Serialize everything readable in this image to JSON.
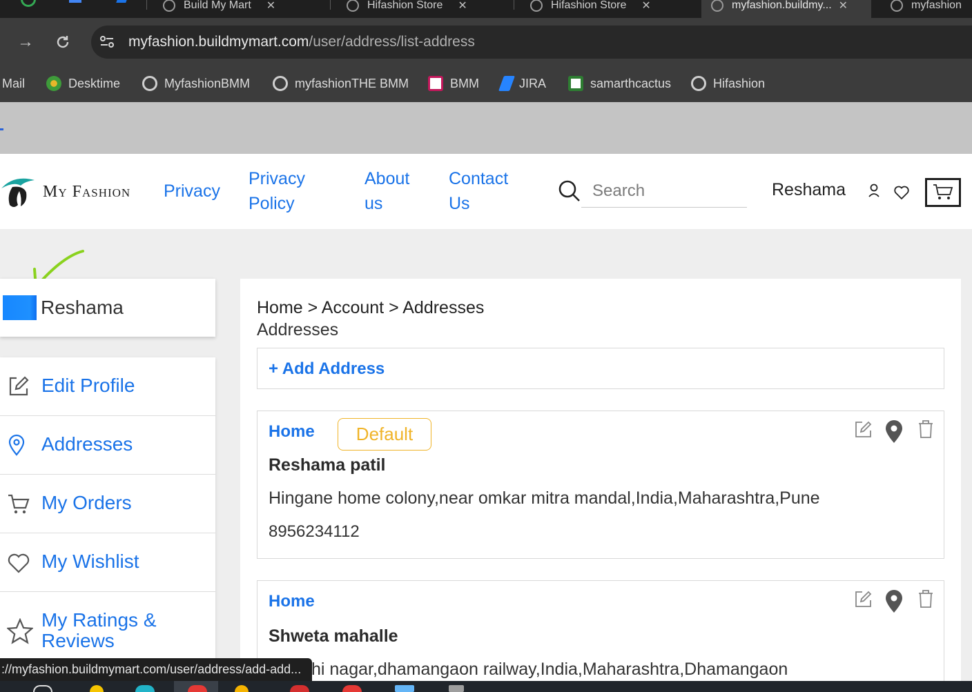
{
  "browser": {
    "tabs": [
      {
        "title": "Build My Mart"
      },
      {
        "title": "Hifashion Store"
      },
      {
        "title": "Hifashion Store"
      },
      {
        "title": "myfashion.buildmy..."
      },
      {
        "title": "myfashion"
      }
    ],
    "url_host": "myfashion.buildmymart.com",
    "url_path": "/user/address/list-address",
    "bookmarks": [
      {
        "label": "Mail"
      },
      {
        "label": "Desktime"
      },
      {
        "label": "MyfashionBMM"
      },
      {
        "label": "myfashionTHE BMM"
      },
      {
        "label": "BMM"
      },
      {
        "label": "JIRA"
      },
      {
        "label": "samarthcactus"
      },
      {
        "label": "Hifashion"
      }
    ],
    "status_url": "://myfashion.buildmymart.com/user/address/add-add..."
  },
  "header": {
    "logo_text": "My Fashion",
    "nav": [
      {
        "label": "Privacy"
      },
      {
        "label": "Privacy Policy"
      },
      {
        "label": "About us"
      },
      {
        "label": "Contact Us"
      }
    ],
    "search_placeholder": "Search",
    "user_name": "Reshama"
  },
  "sidebar": {
    "profile_name": "Reshama",
    "menu": [
      {
        "label": "Edit Profile",
        "icon": "edit-icon"
      },
      {
        "label": "Addresses",
        "icon": "location-pin-icon"
      },
      {
        "label": "My Orders",
        "icon": "cart-icon"
      },
      {
        "label": "My Wishlist",
        "icon": "heart-icon"
      },
      {
        "label": "My Ratings & Reviews",
        "icon": "star-icon"
      }
    ]
  },
  "main": {
    "breadcrumb": "Home > Account > Addresses",
    "title": "Addresses",
    "add_address_label": "+ Add Address",
    "addresses": [
      {
        "type": "Home",
        "badge": "Default",
        "name": "Reshama patil",
        "address": "Hingane home colony,near omkar mitra mandal,India,Maharashtra,Pune",
        "phone": "8956234112"
      },
      {
        "type": "Home",
        "name": "Shweta mahalle",
        "address": "hi nagar,dhamangaon railway,India,Maharashtra,Dhamangaon"
      }
    ]
  },
  "colors": {
    "link": "#1a73e8",
    "default_badge": "#f0b429",
    "arrow_annotation": "#8ad21e"
  }
}
